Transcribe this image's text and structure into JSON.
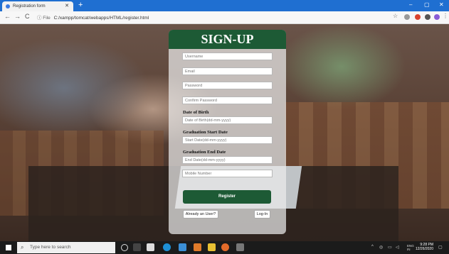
{
  "browser": {
    "tab_title": "Registration form",
    "tab_close": "✕",
    "new_tab": "+",
    "url_info": "ⓘ File",
    "url": "C:/xampp/tomcat/webapps/HTML/register.html",
    "controls": {
      "minimize": "–",
      "maximize": "▢",
      "close": "✕"
    },
    "nav": {
      "back": "←",
      "forward": "→",
      "reload": "C"
    }
  },
  "form": {
    "title": "SIGN-UP",
    "fields": {
      "username": {
        "placeholder": "Username"
      },
      "email": {
        "placeholder": "Email"
      },
      "password": {
        "placeholder": "Password"
      },
      "confirm_password": {
        "placeholder": "Confirm Password"
      },
      "dob": {
        "label": "Date of Birth",
        "placeholder": "Date of Birth(dd-mm-yyyy)"
      },
      "grad_start": {
        "label": "Graduation Start Date",
        "placeholder": "Start Date(dd-mm-yyyy)"
      },
      "grad_end": {
        "label": "Graduation End Date",
        "placeholder": "End Date(dd-mm-yyyy)"
      },
      "mobile": {
        "placeholder": "Mobile Number"
      }
    },
    "register_label": "Register",
    "already_user_label": "Already an User?",
    "login_label": "Log-In"
  },
  "taskbar": {
    "search_placeholder": "Type here to search",
    "clock_time": "9:28 PM",
    "clock_date": "12/26/2020",
    "lang_top": "ENG",
    "lang_bottom": "IN"
  },
  "colors": {
    "accent_green": "#1d5a35",
    "tab_blue": "#1f6fd1"
  }
}
